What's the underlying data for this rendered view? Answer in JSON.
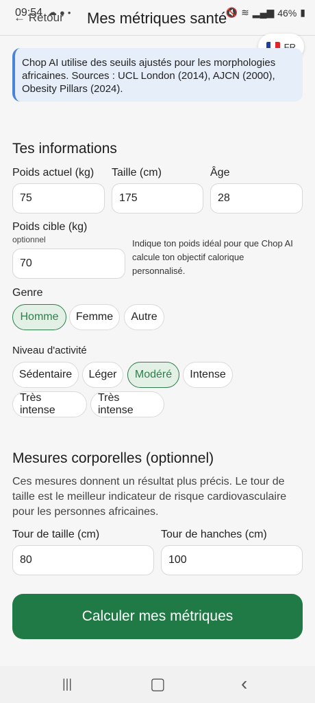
{
  "status_bar": {
    "time": "09:54",
    "battery": "46%",
    "icons_left": [
      "cloud-icon",
      "app-icon",
      "dot-icon"
    ],
    "icons_right": [
      "mute-icon",
      "wifi-icon",
      "signal-icon",
      "battery-icon"
    ]
  },
  "header": {
    "back_label": "← Retour",
    "title": "Mes métriques santé",
    "lang_label": "FR",
    "flag_colors": [
      "#1f3f9e",
      "#ffffff",
      "#e0262b"
    ]
  },
  "info": {
    "text": "Chop AI utilise des seuils ajustés pour les morphologies africaines. Sources : UCL London (2014), AJCN (2000), Obesity Pillars (2024)."
  },
  "infos_section": {
    "title": "Tes informations",
    "weight_label": "Poids actuel (kg)",
    "weight_value": "75",
    "height_label": "Taille (cm)",
    "height_value": "175",
    "age_label": "Âge",
    "age_value": "28",
    "target_label": "Poids cible (kg)",
    "target_sub": "optionnel",
    "target_value": "70",
    "target_hint": "Indique ton poids idéal pour que Chop AI calcule ton objectif calorique personnalisé.",
    "gender_label": "Genre",
    "genders": [
      "Homme",
      "Femme",
      "Autre"
    ],
    "gender_selected": "Homme",
    "activity_label": "Niveau d'activité",
    "activities": [
      "Sédentaire",
      "Léger",
      "Modéré",
      "Intense",
      "Très intense",
      "Très intense"
    ],
    "activity_selected": "Modéré"
  },
  "body_section": {
    "title": "Mesures corporelles (optionnel)",
    "description": "Ces mesures donnent un résultat plus précis. Le tour de taille est le meilleur indicateur de risque cardiovasculaire pour les personnes africaines.",
    "waist_label": "Tour de taille (cm)",
    "waist_value": "80",
    "hips_label": "Tour de hanches (cm)",
    "hips_value": "100"
  },
  "cta": {
    "label": "Calculer mes métriques"
  },
  "navbar": {
    "recent": "|||",
    "home": "▢",
    "back": "‹"
  }
}
